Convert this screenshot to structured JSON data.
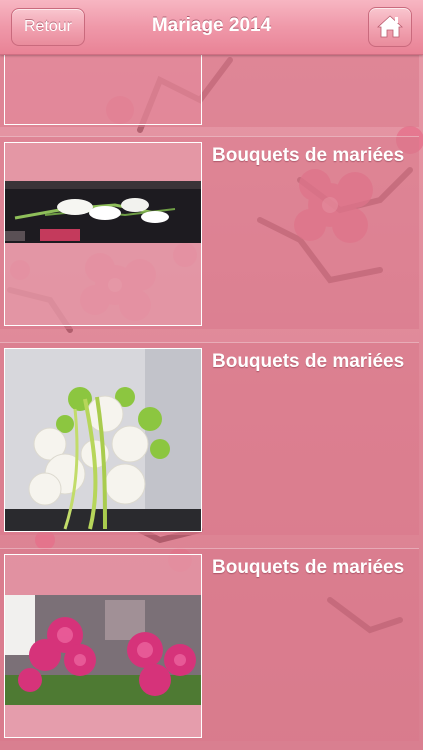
{
  "header": {
    "back_label": "Retour",
    "title": "Mariage 2014",
    "home_icon": "home-icon"
  },
  "list": {
    "items": [
      {
        "title": "Bouquets de mariées",
        "image": "calla-lily-bouquet-photo"
      },
      {
        "title": "Bouquets de mariées",
        "image": "white-rose-calla-bouquet-photo"
      },
      {
        "title": "Bouquets de mariées",
        "image": "pink-peony-arrangement-photo"
      }
    ]
  },
  "colors": {
    "header_pink": "#ef98a9",
    "background_pink": "#df8797",
    "text": "#ffffff"
  }
}
